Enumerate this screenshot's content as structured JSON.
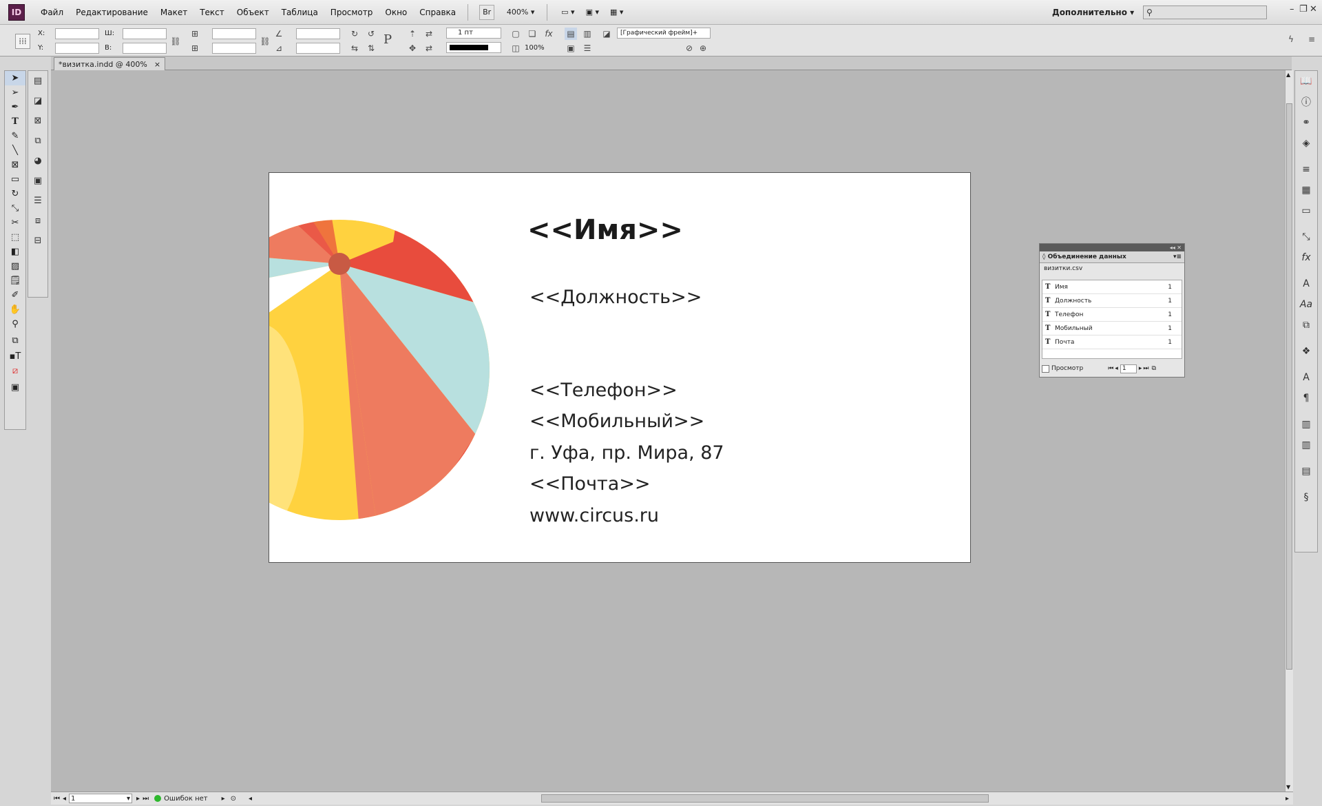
{
  "menubar": {
    "logo": "ID",
    "items": [
      "Файл",
      "Редактирование",
      "Макет",
      "Текст",
      "Объект",
      "Таблица",
      "Просмотр",
      "Окно",
      "Справка"
    ],
    "bridge": "Br",
    "zoom": "400%",
    "workspace": "Дополнительно"
  },
  "control": {
    "x_label": "X:",
    "y_label": "Y:",
    "w_label": "Ш:",
    "h_label": "В:",
    "stroke_weight": "1 пт",
    "opacity": "100%",
    "object_style": "[Графический фрейм]+"
  },
  "document_tab": {
    "label": "*визитка.indd @ 400%",
    "close": "×"
  },
  "card": {
    "name": "<<Имя>>",
    "position": "<<Должность>>",
    "phone": "<<Телефон>>",
    "mobile": "<<Мобильный>>",
    "address": "г. Уфа, пр. Мира, 87",
    "email": "<<Почта>>",
    "website": "www.circus.ru"
  },
  "data_merge": {
    "title": "Объединение данных",
    "file": "визитки.csv",
    "fields": [
      {
        "label": "Имя",
        "count": "1"
      },
      {
        "label": "Должность",
        "count": "1"
      },
      {
        "label": "Телефон",
        "count": "1"
      },
      {
        "label": "Мобильный",
        "count": "1"
      },
      {
        "label": "Почта",
        "count": "1"
      }
    ],
    "preview_label": "Просмотр",
    "record": "1"
  },
  "status": {
    "page": "1",
    "errors": "Ошибок нет"
  },
  "colors": {
    "ball_red": "#e84c3d",
    "ball_salmon": "#ee7b5f",
    "ball_yellow": "#ffd23f",
    "ball_lightblue": "#b8e0df",
    "ball_center": "#c85a44",
    "status_ok": "#2db82d"
  }
}
